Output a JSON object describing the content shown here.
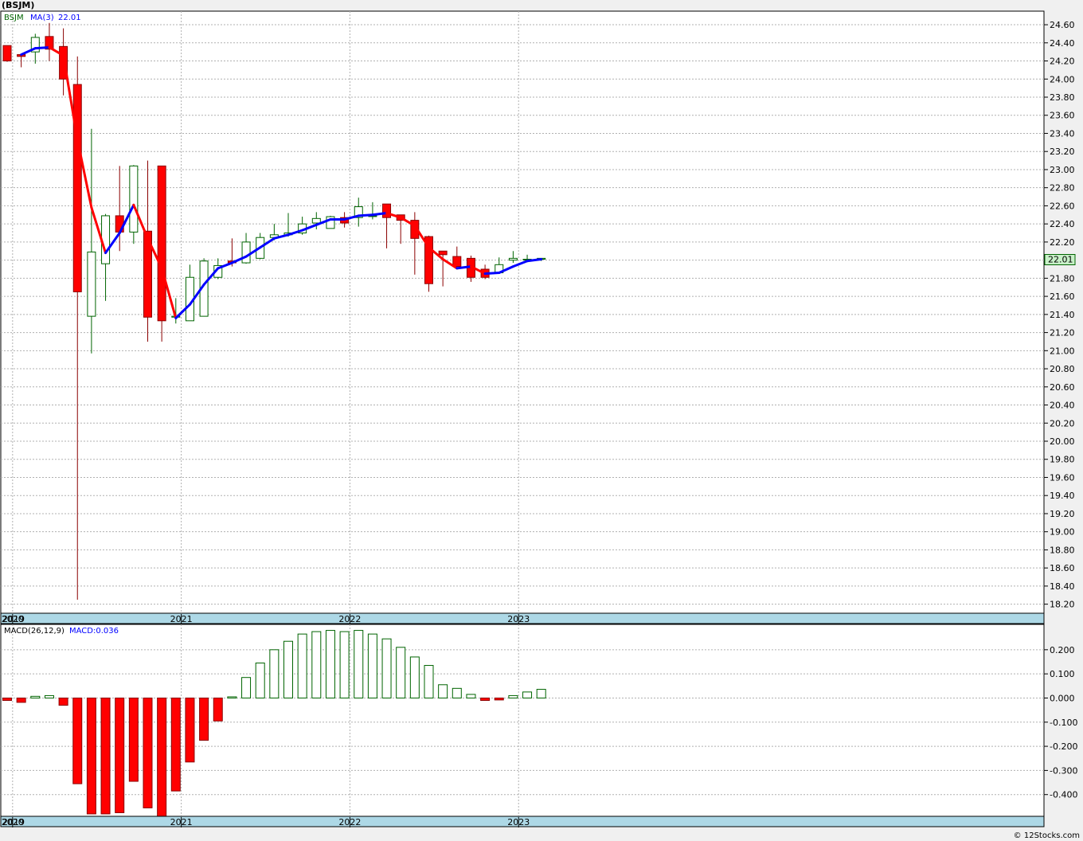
{
  "title": "(BSJM)",
  "footer": "© 12Stocks.com",
  "colors": {
    "up": "#006400",
    "down": "#ff0000",
    "ma_down": "#ff0000",
    "ma_up": "#0000ff",
    "axis_band": "#add8e6",
    "last_label_bg": "#c8f0c8"
  },
  "price_panel": {
    "legend_symbol": "BSJM",
    "legend_ma": "MA(3)",
    "legend_ma_value": "22.01",
    "last_price_label": "22.01",
    "ylim": [
      18.1,
      24.75
    ],
    "yticks": [
      "24.60",
      "24.40",
      "24.20",
      "24.00",
      "23.80",
      "23.60",
      "23.40",
      "23.20",
      "23.00",
      "22.80",
      "22.60",
      "22.40",
      "22.20",
      "22.00",
      "21.80",
      "21.60",
      "21.40",
      "21.20",
      "21.00",
      "20.80",
      "20.60",
      "20.40",
      "20.20",
      "20.00",
      "19.80",
      "19.60",
      "19.40",
      "19.20",
      "19.00",
      "18.80",
      "18.60",
      "18.40",
      "18.20"
    ]
  },
  "macd_panel": {
    "legend_name": "MACD(26,12,9)",
    "legend_value": "MACD:0.036",
    "ylim": [
      -0.49,
      0.305
    ],
    "yticks": [
      "0.200",
      "0.100",
      "0.000",
      "-0.100",
      "-0.200",
      "-0.300",
      "-0.400"
    ]
  },
  "x_axis": {
    "year_labels": [
      "2019",
      "2020",
      "2021",
      "2022",
      "2023"
    ]
  },
  "chart_data": [
    {
      "type": "candlestick",
      "title": "(BSJM)",
      "periods": [
        "2019-12",
        "2020-01",
        "2020-02",
        "2020-03",
        "2020-04",
        "2020-05",
        "2020-06",
        "2020-07",
        "2020-08",
        "2020-09",
        "2020-10",
        "2020-11",
        "2020-12",
        "2021-01",
        "2021-02",
        "2021-03",
        "2021-04",
        "2021-05",
        "2021-06",
        "2021-07",
        "2021-08",
        "2021-09",
        "2021-10",
        "2021-11",
        "2021-12",
        "2022-01",
        "2022-02",
        "2022-03",
        "2022-04",
        "2022-05",
        "2022-06",
        "2022-07",
        "2022-08",
        "2022-09",
        "2022-10",
        "2022-11",
        "2022-12",
        "2023-01",
        "2023-02"
      ],
      "open": [
        24.37,
        24.27,
        24.3,
        24.47,
        24.36,
        23.94,
        21.38,
        21.96,
        22.49,
        22.31,
        22.32,
        23.04,
        21.37,
        21.33,
        21.38,
        21.81,
        21.99,
        21.97,
        22.02,
        22.25,
        22.28,
        22.3,
        22.41,
        22.35,
        22.47,
        22.47,
        22.49,
        22.62,
        22.5,
        22.44,
        22.26,
        22.1,
        22.04,
        22.02,
        21.9,
        21.86,
        22.0,
        22.01,
        22.01
      ],
      "high": [
        24.37,
        24.27,
        24.5,
        24.62,
        24.56,
        24.25,
        23.45,
        22.51,
        23.04,
        23.05,
        23.1,
        21.45,
        21.58,
        21.95,
        22.02,
        22.02,
        22.24,
        22.3,
        22.3,
        22.4,
        22.52,
        22.48,
        22.53,
        22.49,
        22.53,
        22.69,
        22.64,
        22.55,
        22.5,
        22.53,
        22.27,
        22.09,
        22.15,
        22.05,
        21.95,
        22.03,
        22.1,
        22.06,
        22.02
      ],
      "low": [
        24.19,
        24.13,
        24.17,
        24.2,
        23.82,
        18.25,
        20.97,
        21.55,
        22.1,
        22.18,
        21.1,
        21.1,
        21.3,
        21.33,
        21.38,
        21.79,
        21.93,
        21.96,
        22.01,
        22.22,
        22.26,
        22.28,
        22.34,
        22.37,
        22.36,
        22.37,
        22.45,
        22.13,
        22.18,
        21.84,
        21.65,
        21.71,
        21.9,
        21.76,
        21.79,
        21.86,
        21.97,
        21.99,
        21.99
      ],
      "close": [
        24.2,
        24.25,
        24.46,
        24.33,
        24.0,
        21.65,
        22.09,
        22.49,
        22.31,
        23.04,
        21.37,
        21.33,
        21.38,
        21.81,
        21.99,
        21.94,
        21.97,
        22.2,
        22.25,
        22.28,
        22.3,
        22.4,
        22.46,
        22.48,
        22.41,
        22.59,
        22.49,
        22.47,
        22.44,
        22.24,
        21.74,
        22.06,
        21.93,
        21.81,
        21.81,
        21.95,
        22.02,
        22.01,
        22.02
      ],
      "ma3": [
        null,
        24.27,
        24.34,
        24.35,
        24.26,
        23.33,
        22.58,
        22.08,
        22.3,
        22.61,
        22.24,
        21.91,
        21.36,
        21.51,
        21.73,
        21.91,
        21.97,
        22.04,
        22.14,
        22.24,
        22.28,
        22.33,
        22.39,
        22.45,
        22.45,
        22.49,
        22.5,
        22.52,
        22.47,
        22.38,
        22.14,
        22.01,
        21.91,
        21.93,
        21.85,
        21.86,
        21.93,
        21.99,
        22.01
      ],
      "ylim": [
        18.1,
        24.75
      ]
    },
    {
      "type": "bar",
      "title": "MACD(26,12,9)",
      "periods": [
        "2019-12",
        "2020-01",
        "2020-02",
        "2020-03",
        "2020-04",
        "2020-05",
        "2020-06",
        "2020-07",
        "2020-08",
        "2020-09",
        "2020-10",
        "2020-11",
        "2020-12",
        "2021-01",
        "2021-02",
        "2021-03",
        "2021-04",
        "2021-05",
        "2021-06",
        "2021-07",
        "2021-08",
        "2021-09",
        "2021-10",
        "2021-11",
        "2021-12",
        "2022-01",
        "2022-02",
        "2022-03",
        "2022-04",
        "2022-05",
        "2022-06",
        "2022-07",
        "2022-08",
        "2022-09",
        "2022-10",
        "2022-11",
        "2022-12",
        "2023-01",
        "2023-02"
      ],
      "values": [
        -0.01,
        -0.018,
        0.007,
        0.01,
        -0.03,
        -0.355,
        -0.48,
        -0.48,
        -0.475,
        -0.345,
        -0.455,
        -0.495,
        -0.385,
        -0.265,
        -0.175,
        -0.095,
        0.005,
        0.085,
        0.145,
        0.2,
        0.235,
        0.265,
        0.275,
        0.28,
        0.275,
        0.28,
        0.265,
        0.245,
        0.21,
        0.17,
        0.135,
        0.055,
        0.04,
        0.015,
        -0.01,
        -0.008,
        0.01,
        0.025,
        0.036
      ],
      "ylim": [
        -0.49,
        0.305
      ]
    }
  ]
}
